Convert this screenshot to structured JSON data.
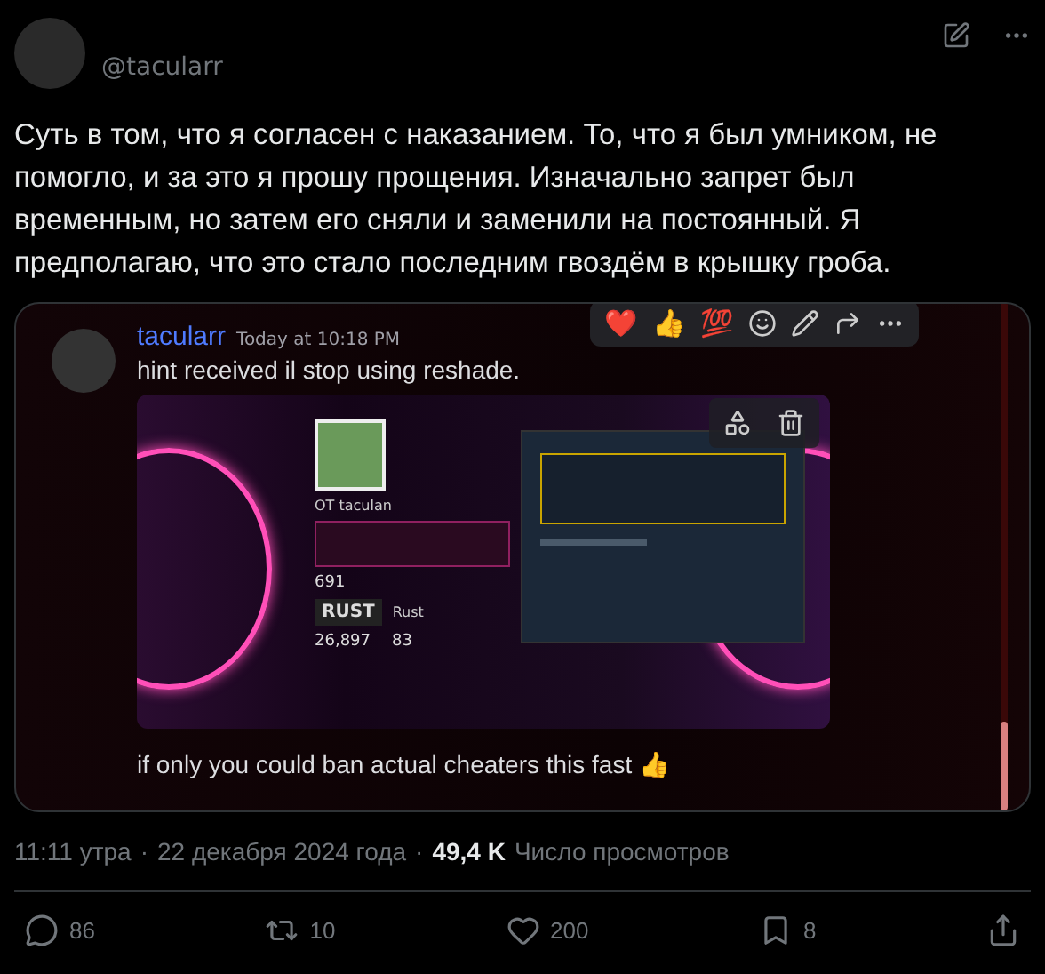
{
  "author": {
    "handle": "@tacularr"
  },
  "text": "Суть в том, что я согласен с наказанием. То, что я был умником, не помогло, и за это я прошу прощения. Изначально запрет был временным, но затем его сняли и заменили на постоянный. Я предполагаю, что это стало последним гвоздём в крышку гроба.",
  "embed": {
    "username": "tacularr",
    "timestamp": "Today at 10:18 PM",
    "message": "hint received il stop using reshade.",
    "reactions": [
      "❤️",
      "👍",
      "💯"
    ],
    "screenshot": {
      "profile_name": "OT taculan",
      "badge_count": "691",
      "game_logo": "RUST",
      "game_name": "Rust",
      "hours": "26,897",
      "achievements": "83"
    },
    "footer_message": "if only you could ban actual cheaters this fast 👍"
  },
  "meta": {
    "time": "11:11 утра",
    "separator": "·",
    "date": "22 декабря 2024 года",
    "views": "49,4 K",
    "views_label": "Число просмотров"
  },
  "actions": [
    {
      "kind": "reply",
      "count": "86"
    },
    {
      "kind": "repost",
      "count": "10"
    },
    {
      "kind": "like",
      "count": "200"
    },
    {
      "kind": "bookmark",
      "count": "8"
    },
    {
      "kind": "share"
    }
  ]
}
